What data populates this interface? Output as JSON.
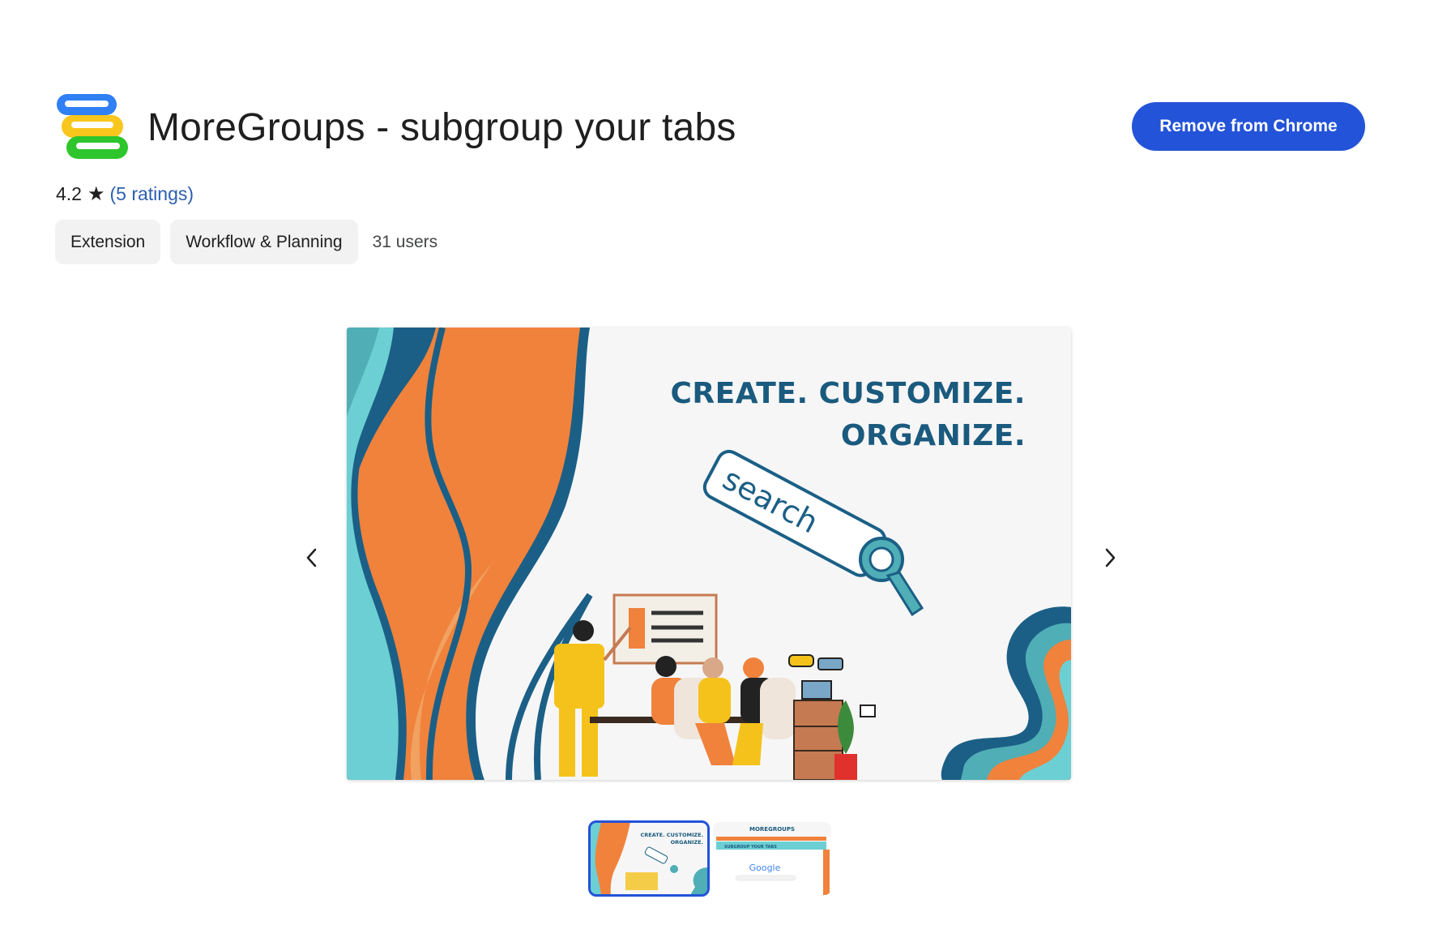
{
  "extension": {
    "title": "MoreGroups - subgroup your tabs",
    "rating": "4.2",
    "ratings_link": "(5 ratings)",
    "users": "31 users",
    "chips": [
      "Extension",
      "Workflow & Planning"
    ]
  },
  "actions": {
    "remove_label": "Remove from Chrome"
  },
  "icons": {
    "app": "moregroups-logo-icon",
    "star": "star-icon",
    "prev": "chevron-left-icon",
    "next": "chevron-right-icon"
  },
  "slide": {
    "headline_line1": "CREATE. CUSTOMIZE.",
    "headline_line2": "ORGANIZE.",
    "search_text": "search"
  },
  "thumbnails": {
    "thumb1_line1": "CREATE. CUSTOMIZE.",
    "thumb1_line2": "ORGANIZE.",
    "thumb2_title": "MOREGROUPS",
    "thumb2_subtitle": "SUBGROUP YOUR TABS",
    "thumb2_google": "Google"
  },
  "colors": {
    "primary_button": "#2353d8",
    "link": "#2d5fb0",
    "chip_bg": "#f1f2f1",
    "headline": "#1a5a7e",
    "teal": "#6ccfd3",
    "orange": "#f0823c",
    "light_orange": "#f1a160",
    "navy": "#1b5f86",
    "yellow": "#f5c21b"
  }
}
